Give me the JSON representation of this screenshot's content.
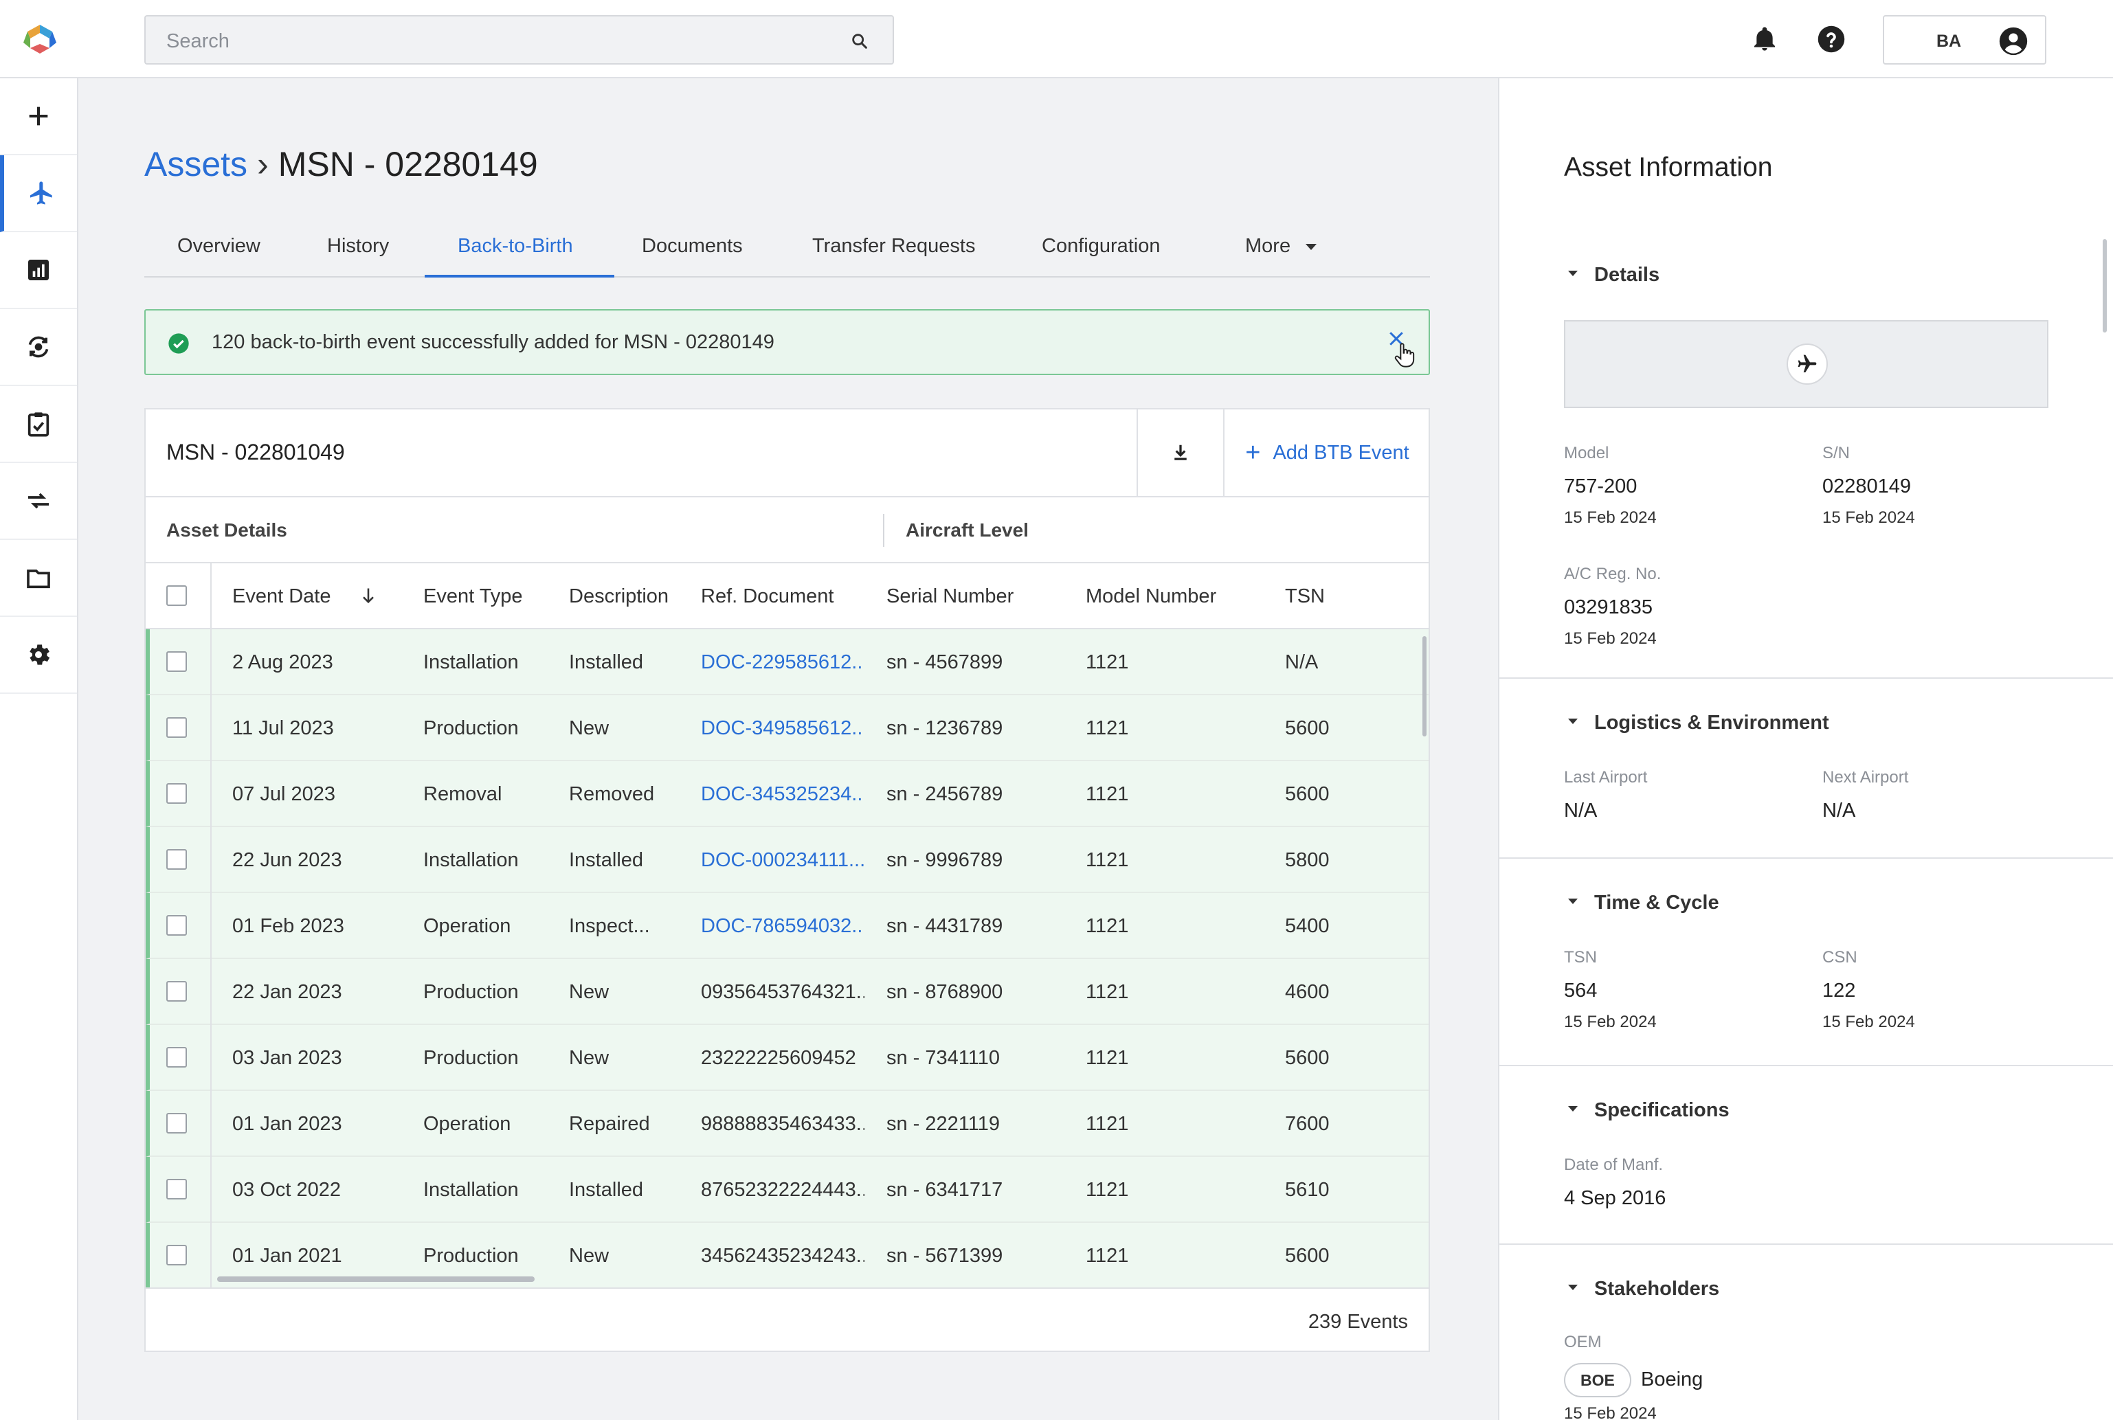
{
  "search": {
    "placeholder": "Search"
  },
  "user": {
    "initials": "BA"
  },
  "breadcrumb": {
    "root": "Assets",
    "separator": "›",
    "current": "MSN - 02280149"
  },
  "tabs": [
    {
      "label": "Overview"
    },
    {
      "label": "History"
    },
    {
      "label": "Back-to-Birth"
    },
    {
      "label": "Documents"
    },
    {
      "label": "Transfer Requests"
    },
    {
      "label": "Configuration"
    },
    {
      "label": "More"
    }
  ],
  "alert": {
    "message": "120 back-to-birth event successfully added for MSN - 02280149"
  },
  "table_card": {
    "title": "MSN - 022801049",
    "add_label": "Add BTB Event",
    "group_left": "Asset Details",
    "group_right": "Aircraft Level",
    "columns": [
      "Event Date",
      "Event Type",
      "Description",
      "Ref. Document",
      "Serial Number",
      "Model Number",
      "TSN"
    ],
    "rows": [
      {
        "date": "2 Aug 2023",
        "type": "Installation",
        "desc": "Installed",
        "ref": "DOC-229585612...",
        "ref_link": true,
        "serial": "sn - 4567899",
        "model": "1121",
        "tsn": "N/A"
      },
      {
        "date": "11 Jul 2023",
        "type": "Production",
        "desc": "New",
        "ref": "DOC-349585612...",
        "ref_link": true,
        "serial": "sn - 1236789",
        "model": "1121",
        "tsn": "5600"
      },
      {
        "date": "07 Jul 2023",
        "type": "Removal",
        "desc": "Removed",
        "ref": "DOC-345325234...",
        "ref_link": true,
        "serial": "sn - 2456789",
        "model": "1121",
        "tsn": "5600"
      },
      {
        "date": "22 Jun 2023",
        "type": "Installation",
        "desc": "Installed",
        "ref": "DOC-000234111...",
        "ref_link": true,
        "serial": "sn - 9996789",
        "model": "1121",
        "tsn": "5800"
      },
      {
        "date": "01 Feb 2023",
        "type": "Operation",
        "desc": "Inspect...",
        "ref": "DOC-786594032...",
        "ref_link": true,
        "serial": "sn - 4431789",
        "model": "1121",
        "tsn": "5400"
      },
      {
        "date": "22 Jan 2023",
        "type": "Production",
        "desc": "New",
        "ref": "09356453764321..",
        "ref_link": false,
        "serial": "sn - 8768900",
        "model": "1121",
        "tsn": "4600"
      },
      {
        "date": "03 Jan 2023",
        "type": "Production",
        "desc": "New",
        "ref": "23222225609452",
        "ref_link": false,
        "serial": "sn - 7341110",
        "model": "1121",
        "tsn": "5600"
      },
      {
        "date": "01 Jan 2023",
        "type": "Operation",
        "desc": "Repaired",
        "ref": "98888835463433..",
        "ref_link": false,
        "serial": "sn - 2221119",
        "model": "1121",
        "tsn": "7600"
      },
      {
        "date": "03 Oct 2022",
        "type": "Installation",
        "desc": "Installed",
        "ref": "87652322224443..",
        "ref_link": false,
        "serial": "sn - 6341717",
        "model": "1121",
        "tsn": "5610"
      },
      {
        "date": "01 Jan 2021",
        "type": "Production",
        "desc": "New",
        "ref": "34562435234243..",
        "ref_link": false,
        "serial": "sn - 5671399",
        "model": "1121",
        "tsn": "5600"
      }
    ],
    "total": "239 Events"
  },
  "asset_info": {
    "title": "Asset Information",
    "details": {
      "heading": "Details",
      "model_label": "Model",
      "model_value": "757-200",
      "model_date": "15 Feb 2024",
      "sn_label": "S/N",
      "sn_value": "02280149",
      "sn_date": "15 Feb 2024",
      "reg_label": "A/C Reg. No.",
      "reg_value": "03291835",
      "reg_date": "15 Feb 2024"
    },
    "logistics": {
      "heading": "Logistics & Environment",
      "last_label": "Last Airport",
      "last_value": "N/A",
      "next_label": "Next Airport",
      "next_value": "N/A"
    },
    "time_cycle": {
      "heading": "Time & Cycle",
      "tsn_label": "TSN",
      "tsn_value": "564",
      "tsn_date": "15 Feb 2024",
      "csn_label": "CSN",
      "csn_value": "122",
      "csn_date": "15 Feb 2024"
    },
    "specifications": {
      "heading": "Specifications",
      "manf_label": "Date of Manf.",
      "manf_value": "4 Sep 2016"
    },
    "stakeholders": {
      "heading": "Stakeholders",
      "oem_label": "OEM",
      "oem_chip": "BOE",
      "oem_name": "Boeing",
      "oem_date": "15 Feb 2024"
    }
  },
  "colors": {
    "accent": "#2a6fd6",
    "success_bg": "#eaf6ee",
    "success_border": "#7bc795",
    "success_icon": "#1f9d55"
  }
}
